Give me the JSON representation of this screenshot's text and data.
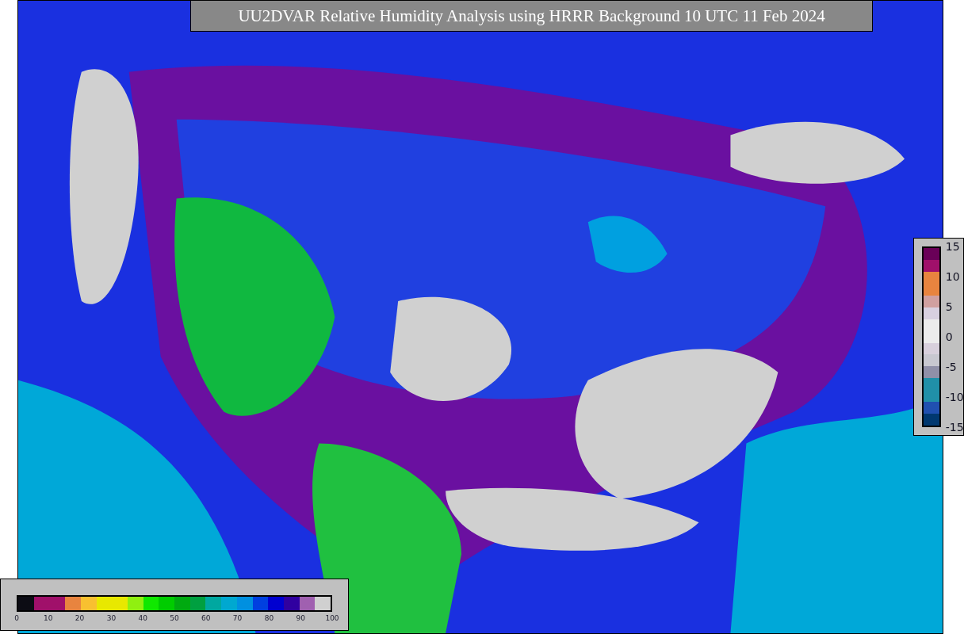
{
  "title": "UU2DVAR Relative Humidity Analysis using HRRR Background 10 UTC 11 Feb 2024",
  "humidity_scale": {
    "segments": [
      {
        "color": "#0c0c14"
      },
      {
        "color": "#a0106a"
      },
      {
        "color": "#a0106a"
      },
      {
        "color": "#e8843f"
      },
      {
        "color": "#f8c030"
      },
      {
        "color": "#e8e800"
      },
      {
        "color": "#e8e800"
      },
      {
        "color": "#90f010"
      },
      {
        "color": "#10e800"
      },
      {
        "color": "#00cc00"
      },
      {
        "color": "#00aa10"
      },
      {
        "color": "#00a040"
      },
      {
        "color": "#00a8a0"
      },
      {
        "color": "#00a8d0"
      },
      {
        "color": "#0090e0"
      },
      {
        "color": "#0040e0"
      },
      {
        "color": "#0000d0"
      },
      {
        "color": "#3000a0"
      },
      {
        "color": "#a060b0"
      },
      {
        "color": "#d0d0d0"
      }
    ],
    "ticks": [
      "0",
      "10",
      "20",
      "30",
      "40",
      "50",
      "60",
      "70",
      "80",
      "90",
      "100"
    ]
  },
  "difference_scale": {
    "segments": [
      {
        "color": "#6a0058"
      },
      {
        "color": "#a0106a"
      },
      {
        "color": "#e8843f"
      },
      {
        "color": "#e8843f"
      },
      {
        "color": "#d0a0a0"
      },
      {
        "color": "#d8d0e0"
      },
      {
        "color": "#ececec"
      },
      {
        "color": "#ececec"
      },
      {
        "color": "#d8d0dc"
      },
      {
        "color": "#c8c8d0"
      },
      {
        "color": "#9090a8"
      },
      {
        "color": "#2090a8"
      },
      {
        "color": "#2090a8"
      },
      {
        "color": "#2050b0"
      },
      {
        "color": "#003870"
      }
    ],
    "ticks": [
      "15",
      "10",
      "5",
      "0",
      "-5",
      "-10",
      "-15"
    ]
  }
}
